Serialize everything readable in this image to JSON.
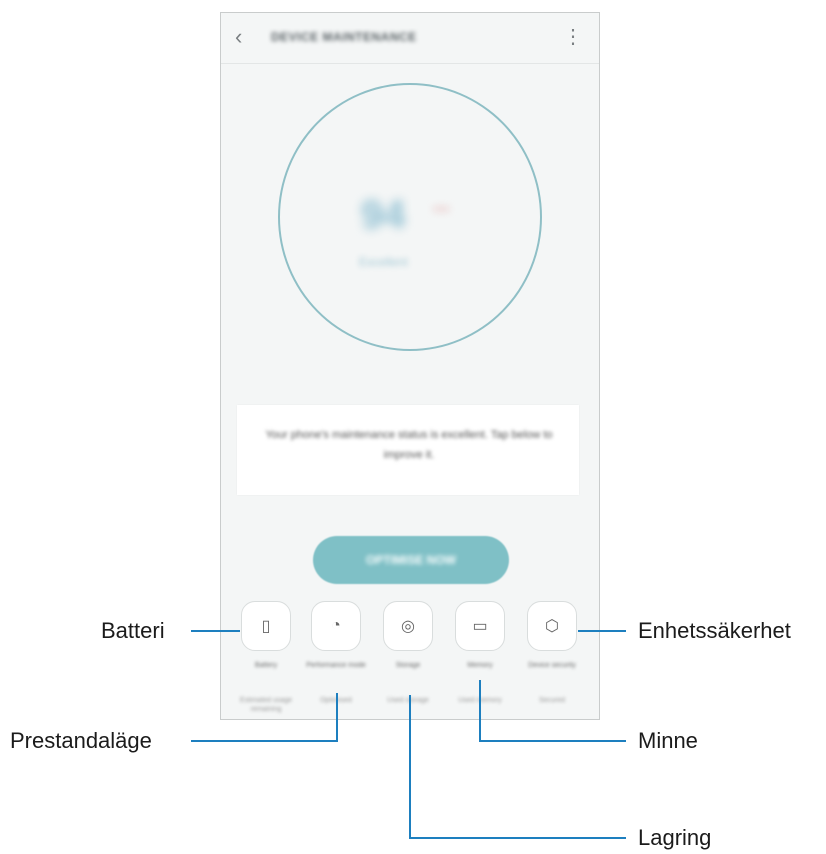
{
  "phone": {
    "header": {
      "back_icon": "chevron-left",
      "title": "DEVICE MAINTENANCE",
      "more_icon": "more-vertical"
    },
    "score": {
      "value": "94",
      "tag": "***",
      "label": "Excellent"
    },
    "status_message": "Your phone's maintenance status is excellent. Tap below to improve it.",
    "optimize_label": "OPTIMISE NOW",
    "categories": [
      {
        "icon": "battery-icon",
        "glyph": "▯",
        "label": "Battery",
        "sub": "Estimated usage remaining"
      },
      {
        "icon": "speedometer-icon",
        "glyph": "◔",
        "label": "Performance mode",
        "sub": "Optimised"
      },
      {
        "icon": "storage-icon",
        "glyph": "◎",
        "label": "Storage",
        "sub": "Used storage"
      },
      {
        "icon": "memory-icon",
        "glyph": "▭",
        "label": "Memory",
        "sub": "Used memory"
      },
      {
        "icon": "shield-icon",
        "glyph": "⬡",
        "label": "Device security",
        "sub": "Secured"
      }
    ]
  },
  "callouts": {
    "battery": "Batteri",
    "performance": "Prestandaläge",
    "storage": "Lagring",
    "memory": "Minne",
    "security": "Enhetssäkerhet"
  },
  "colors": {
    "accent": "#7fc0c6",
    "ring": "#8fbfc6",
    "callout_line": "#1d7fbf"
  }
}
